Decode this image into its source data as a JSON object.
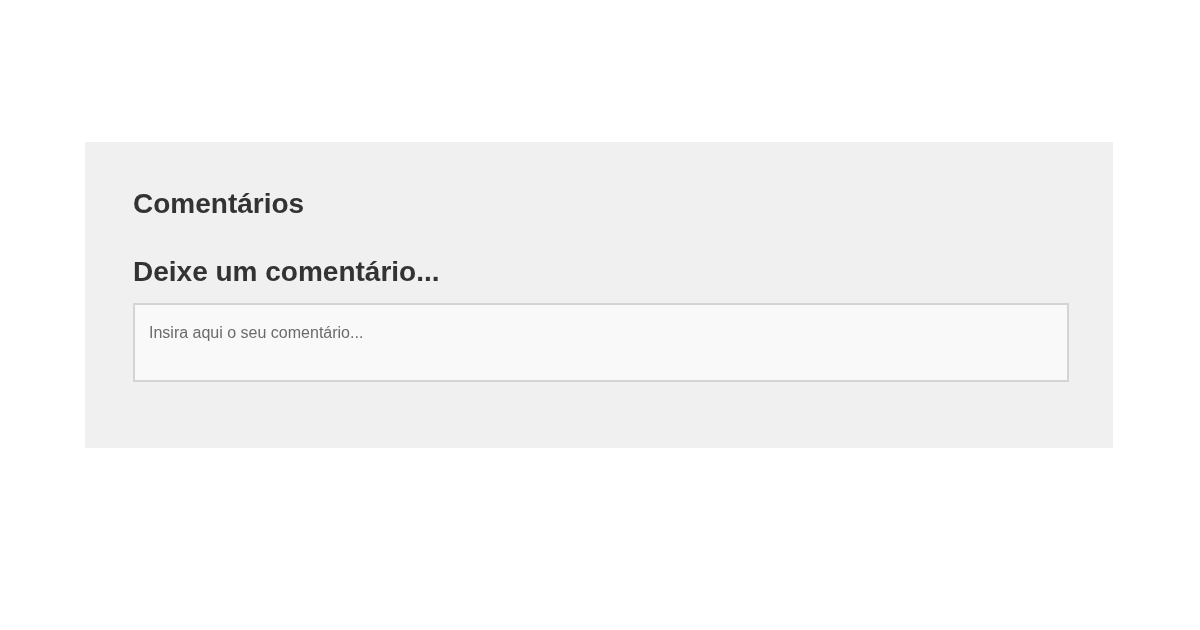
{
  "section_title": "Comentários",
  "form_title": "Deixe um comentário...",
  "comment_field": {
    "placeholder": "Insira aqui o seu comentário..."
  }
}
